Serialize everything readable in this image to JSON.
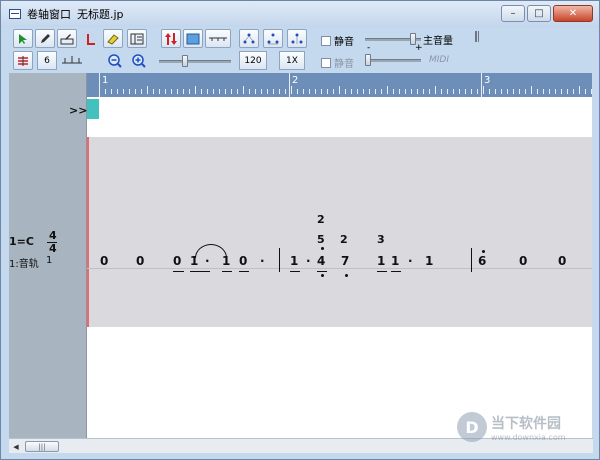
{
  "window": {
    "title": "卷轴窗口",
    "filename": "无标题.jp"
  },
  "window_buttons": {
    "minimize": "–",
    "maximize": "□",
    "close": "✕"
  },
  "toolbar": {
    "note_value": "6",
    "tempo_value": "120",
    "speed_value": "1X",
    "mute1_label": "静音",
    "mute2_label": "静音",
    "master_volume_label": "主音量",
    "minus_sign": "-",
    "plus_sign": "+",
    "midi_label": "MIDI",
    "master_volume_level": 0.9,
    "zoom_slider_level": 0.35,
    "midi_slider_level": 0.0
  },
  "ruler": {
    "measures": [
      "1",
      "2",
      "3"
    ]
  },
  "track": {
    "expand_marker": ">>",
    "key": "1=C",
    "time_sig_top": "4",
    "time_sig_bottom": "4",
    "name": "1:音轨",
    "number": "1"
  },
  "score": {
    "notes": [
      "0",
      "0",
      "0",
      "1",
      "·",
      "1",
      "0",
      "·",
      "1",
      "·",
      "4",
      "7",
      "1",
      "1",
      "·",
      "1",
      "6",
      "0",
      "0"
    ],
    "chord_upper": [
      "2",
      "5",
      "2",
      "3"
    ]
  },
  "watermark": {
    "name": "当下软件园",
    "url": "www.downxia.com"
  }
}
